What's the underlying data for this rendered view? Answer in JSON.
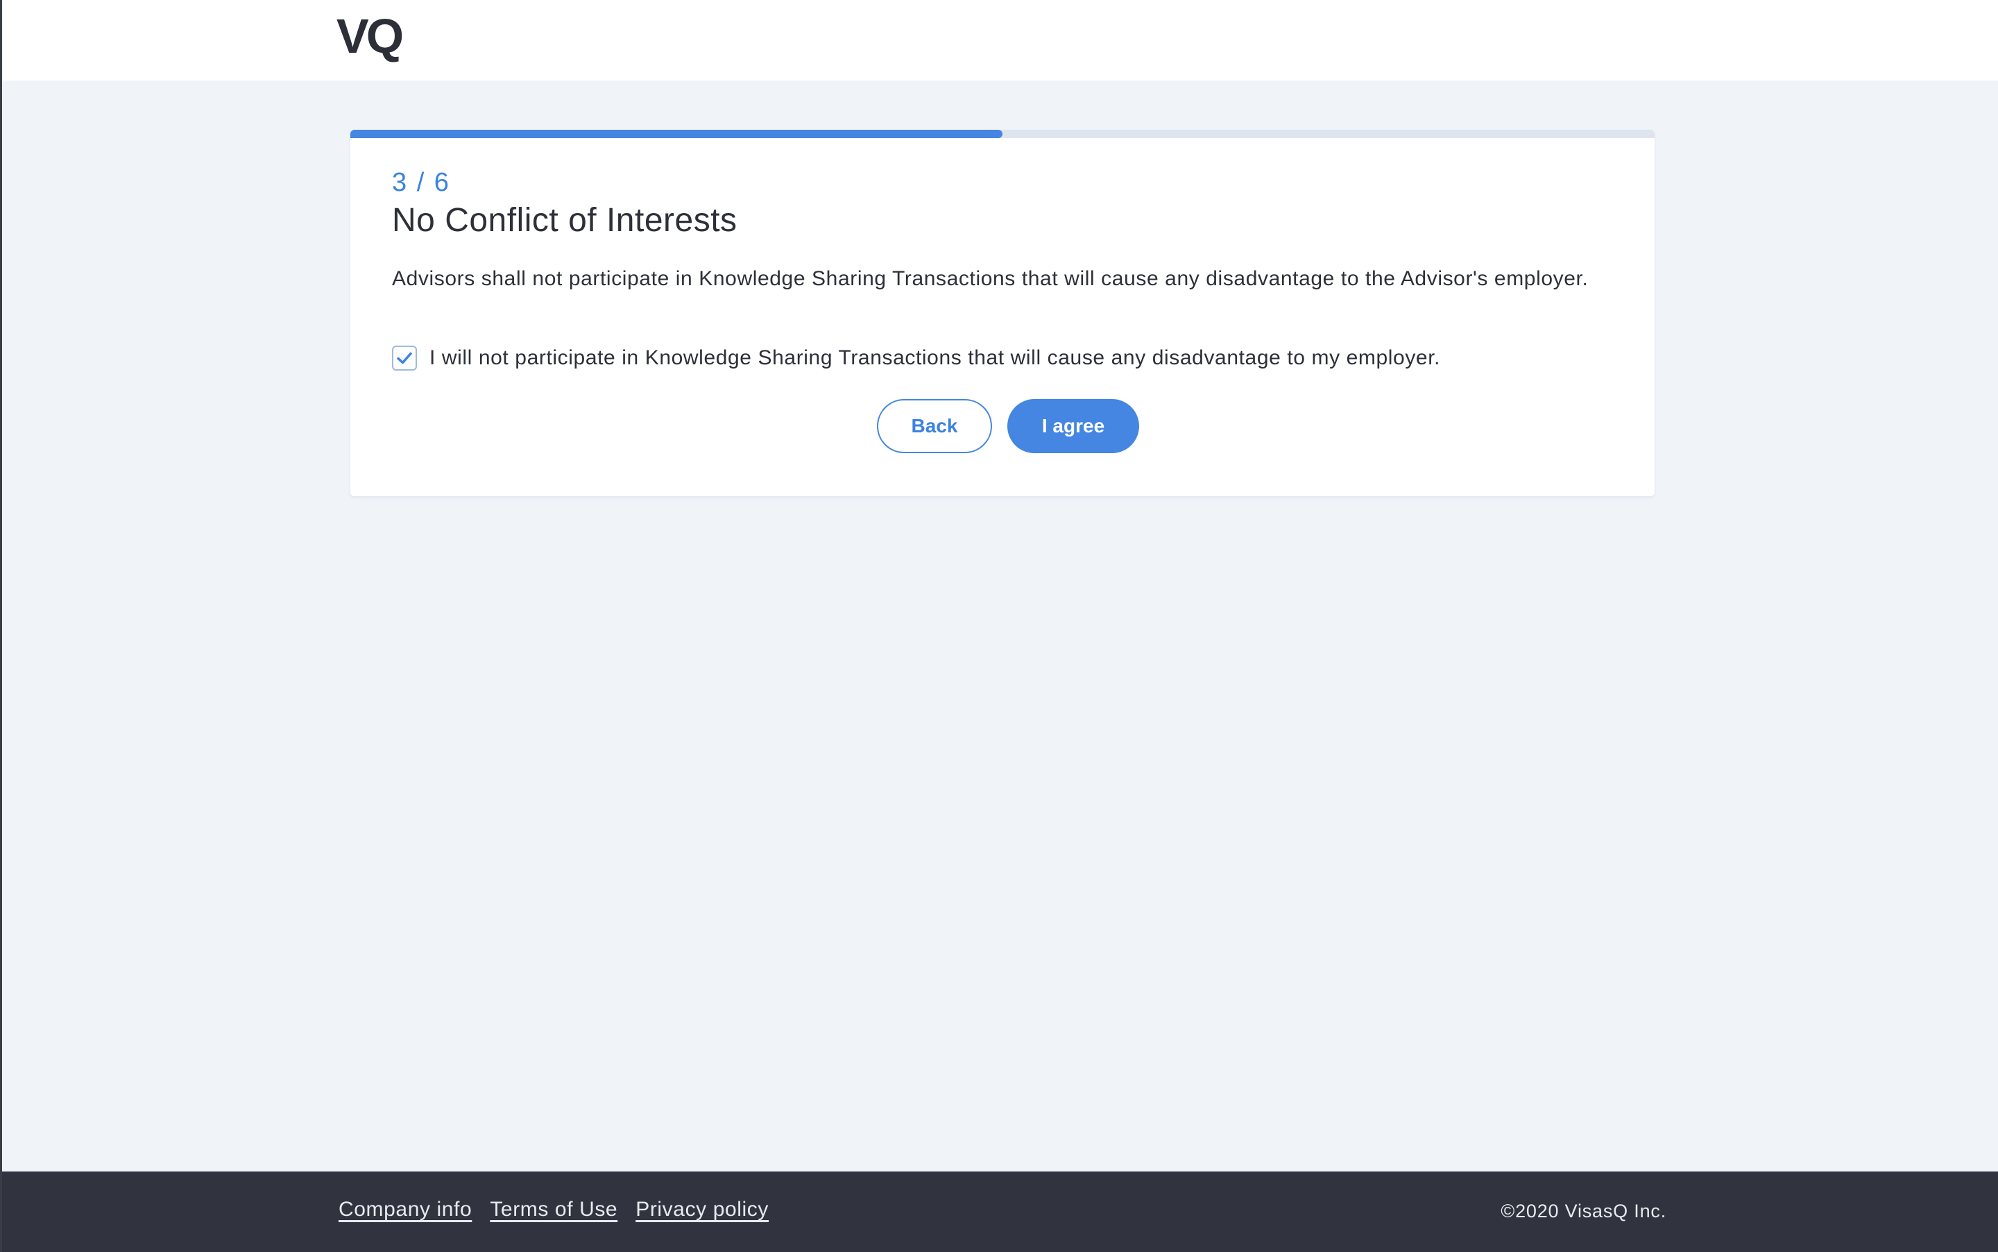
{
  "header": {
    "logo": "VQ"
  },
  "progress": {
    "current": 3,
    "total": 6,
    "fraction": 0.5
  },
  "form": {
    "step_label": "3 / 6",
    "title": "No Conflict of Interests",
    "description": "Advisors shall not participate in Knowledge Sharing Transactions that will cause any disadvantage to the Advisor's employer.",
    "checkbox_label": "I will not participate in Knowledge Sharing Transactions that will cause any disadvantage to my employer.",
    "checkbox_checked": true,
    "back_label": "Back",
    "agree_label": "I agree"
  },
  "footer": {
    "links": [
      "Company info",
      "Terms of Use",
      "Privacy policy"
    ],
    "copyright": "©2020 VisasQ Inc."
  },
  "colors": {
    "accent": "#4486e2",
    "page_background": "#f0f4f9",
    "footer_background": "#31343e",
    "text": "#2d3038"
  }
}
